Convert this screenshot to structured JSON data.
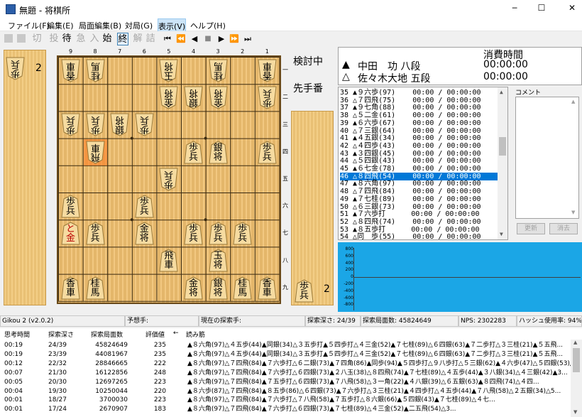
{
  "window": {
    "title": "無題 - 将棋所",
    "minimize": "─",
    "maximize": "☐",
    "close": "✕"
  },
  "menu": [
    "ファイル(F)",
    "編集(E)",
    "局面編集(B)",
    "対局(G)",
    "表示(V)",
    "ヘルプ(H)"
  ],
  "toolbar": {
    "cut": "切",
    "toryo": "投",
    "matta": "待",
    "kyu": "急",
    "nyu": "入",
    "start": "始",
    "end": "終",
    "kai": "解",
    "tsume": "詰",
    "first": "⏮",
    "prev10": "⏪",
    "prev": "◀",
    "stop": "■",
    "next": "▶",
    "next10": "⏩",
    "last": "⏭"
  },
  "board": {
    "files": [
      "9",
      "8",
      "7",
      "6",
      "5",
      "4",
      "3",
      "2",
      "1"
    ],
    "ranks": [
      "一",
      "二",
      "三",
      "四",
      "五",
      "六",
      "七",
      "八",
      "九"
    ],
    "pieces": [
      {
        "f": 9,
        "r": 1,
        "c": "香",
        "side": "gote"
      },
      {
        "f": 8,
        "r": 1,
        "c": "桂",
        "side": "gote"
      },
      {
        "f": 5,
        "r": 1,
        "c": "玉",
        "side": "gote"
      },
      {
        "f": 3,
        "r": 1,
        "c": "桂",
        "side": "gote"
      },
      {
        "f": 1,
        "r": 1,
        "c": "香",
        "side": "gote"
      },
      {
        "f": 5,
        "r": 2,
        "c": "金",
        "side": "gote"
      },
      {
        "f": 4,
        "r": 2,
        "c": "銀",
        "side": "gote"
      },
      {
        "f": 3,
        "r": 2,
        "c": "金",
        "side": "gote"
      },
      {
        "f": 1,
        "r": 2,
        "c": "歩",
        "side": "gote"
      },
      {
        "f": 9,
        "r": 3,
        "c": "歩",
        "side": "gote"
      },
      {
        "f": 8,
        "r": 3,
        "c": "歩",
        "side": "gote"
      },
      {
        "f": 7,
        "r": 3,
        "c": "銀",
        "side": "gote"
      },
      {
        "f": 6,
        "r": 3,
        "c": "歩",
        "side": "gote"
      },
      {
        "f": 8,
        "r": 4,
        "c": "飛",
        "side": "gote"
      },
      {
        "f": 4,
        "r": 4,
        "c": "歩",
        "side": "sente"
      },
      {
        "f": 3,
        "r": 4,
        "c": "銀",
        "side": "sente"
      },
      {
        "f": 1,
        "r": 4,
        "c": "歩",
        "side": "sente"
      },
      {
        "f": 5,
        "r": 5,
        "c": "歩",
        "side": "gote"
      },
      {
        "f": 9,
        "r": 6,
        "c": "歩",
        "side": "sente"
      },
      {
        "f": 6,
        "r": 6,
        "c": "歩",
        "side": "sente"
      },
      {
        "f": 9,
        "r": 7,
        "c": "と",
        "side": "sente",
        "promo": true
      },
      {
        "f": 8,
        "r": 7,
        "c": "歩",
        "side": "sente"
      },
      {
        "f": 6,
        "r": 7,
        "c": "金",
        "side": "sente"
      },
      {
        "f": 4,
        "r": 7,
        "c": "歩",
        "side": "sente"
      },
      {
        "f": 3,
        "r": 7,
        "c": "歩",
        "side": "sente"
      },
      {
        "f": 2,
        "r": 7,
        "c": "歩",
        "side": "sente"
      },
      {
        "f": 5,
        "r": 8,
        "c": "飛",
        "side": "sente"
      },
      {
        "f": 3,
        "r": 8,
        "c": "玉",
        "side": "sente"
      },
      {
        "f": 9,
        "r": 9,
        "c": "香",
        "side": "sente"
      },
      {
        "f": 8,
        "r": 9,
        "c": "桂",
        "side": "sente"
      },
      {
        "f": 4,
        "r": 9,
        "c": "金",
        "side": "sente"
      },
      {
        "f": 3,
        "r": 9,
        "c": "銀",
        "side": "sente"
      },
      {
        "f": 2,
        "r": 9,
        "c": "桂",
        "side": "sente"
      },
      {
        "f": 1,
        "r": 9,
        "c": "香",
        "side": "sente"
      }
    ],
    "highlight": {
      "f": 8,
      "r": 4
    }
  },
  "hands": {
    "gote": {
      "piece": "歩",
      "count": "2"
    },
    "sente": {
      "piece": "歩",
      "count": "2"
    }
  },
  "side_status": {
    "mode": "検討中",
    "turn": "先手番"
  },
  "players": {
    "time_header": "消費時間",
    "sente_mark": "▲",
    "sente_name": "中田　功 八段",
    "sente_time": "00:00:00",
    "gote_mark": "△",
    "gote_name": "佐々木大地 五段",
    "gote_time": "00:00:00"
  },
  "kifu": [
    "35 ▲９六歩(97)    00:00 / 00:00:00",
    "36 △７四飛(75)    00:00 / 00:00:00",
    "37 ▲９七角(88)    00:00 / 00:00:00",
    "38 △５二金(61)    00:00 / 00:00:00",
    "39 ▲６六歩(67)    00:00 / 00:00:00",
    "40 △７三銀(64)    00:00 / 00:00:00",
    "41 ▲４五銀(34)    00:00 / 00:00:00",
    "42 △４四歩(43)    00:00 / 00:00:00",
    "43 ▲３四銀(45)    00:00 / 00:00:00",
    "44 △５四銀(43)    00:00 / 00:00:00",
    "45 ▲６七金(78)    00:00 / 00:00:00",
    "46 △８四飛(54)    00:00 / 00:00:00",
    "47 ▲８六角(97)    00:00 / 00:00:00",
    "48 △７四飛(84)    00:00 / 00:00:00",
    "49 ▲７七桂(89)    00:00 / 00:00:00",
    "50 △６三銀(73)    00:00 / 00:00:00",
    "51 ▲７六歩打      00:00 / 00:00:00",
    "52 △８四飛(74)    00:00 / 00:00:00",
    "53 ▲８五歩打      00:00 / 00:00:00",
    "54 △同　歩(55)    00:00 / 00:00:00"
  ],
  "kifu_selected": 11,
  "comment": {
    "label": "コメント",
    "update": "更新",
    "clear": "消去"
  },
  "graph": {
    "ylabels": [
      "800",
      "600",
      "400",
      "200",
      "0",
      "-200",
      "-400",
      "-600",
      "-800"
    ]
  },
  "status": {
    "engine": "Gikou 2 (v2.0.2)",
    "expected": "予想手:",
    "current": "現在の探索手:",
    "depth": "探索深さ: 24/39",
    "nodes": "探索局面数: 45824649",
    "nps": "NPS: 2302283",
    "hash": "ハッシュ使用率: 94%"
  },
  "analysis": {
    "headers": [
      "思考時間",
      "探索深さ",
      "探索局面数",
      "評価値",
      "←",
      "読み筋"
    ],
    "rows": [
      [
        "00:19",
        "24/39",
        "45824649",
        "235",
        "",
        "▲８六角(97)△４五歩(44)▲同銀(34)△３五歩打▲５四歩打△４三金(52)▲７七桂(89)△６四銀(63)▲７二歩打△３三桂(21)▲５五飛..."
      ],
      [
        "00:19",
        "23/39",
        "44081967",
        "235",
        "",
        "▲８六角(97)△４五歩(44)▲同銀(34)△３五歩打▲５四歩打△４三金(52)▲７七桂(89)△６四銀(63)▲７二歩打△３三桂(21)▲５五飛..."
      ],
      [
        "00:12",
        "22/32",
        "28846665",
        "222",
        "",
        "▲８六角(97)△７四飛(84)▲７六歩打△６二銀(73)▲７四角(86)▲同歩(94)▲５四歩打△９八歩打△５三銀(62)▲４六歩(47)△５四銀(53)▲2..."
      ],
      [
        "00:07",
        "21/30",
        "16122856",
        "248",
        "",
        "▲８六角(97)△７四飛(84)▲７六歩打△６四銀(73)▲２八玉(38)△８四飛(74)▲７七桂(89)△４五歩(44)▲３八銀(34)△４三銀(42)▲3..."
      ],
      [
        "00:05",
        "20/30",
        "12697265",
        "223",
        "",
        "▲８六角(97)△７四飛(84)▲７五歩打△６四銀(73)▲７八飛(58)△３一角(22)▲４八銀(39)△６五銀(63)▲８四飛(74)△４四..."
      ],
      [
        "00:04",
        "19/30",
        "10250044",
        "220",
        "",
        "▲８六歩(87)△７四飛(84)▲８五歩(86)△６四銀(73)▲７六歩打△３三桂(21)▲４四歩打△４五歩(44)▲７八飛(58)△２五銀(34)△5..."
      ],
      [
        "00:01",
        "18/27",
        "3700030",
        "223",
        "",
        "▲８六角(97)△７四飛(84)▲７六歩打△７八飛(58)▲７五歩打△８六銀(66)▲５四銀(43)▲７七桂(89)△４七..."
      ],
      [
        "00:01",
        "17/24",
        "2670907",
        "183",
        "",
        "▲８六角(97)△７四飛(84)▲７六歩打△６四銀(73)▲７七桂(89)△４三金(52)▲二五飛(54)△3..."
      ]
    ]
  }
}
